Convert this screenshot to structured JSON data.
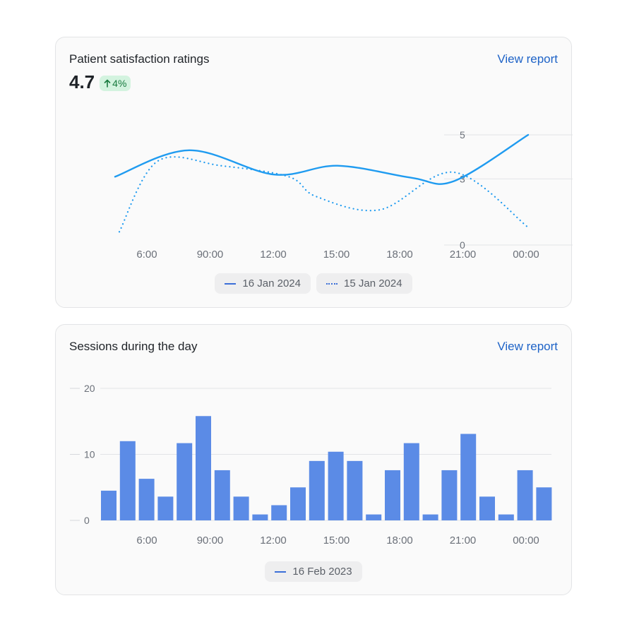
{
  "cards": [
    {
      "title": "Patient satisfaction ratings",
      "link": "View report",
      "kpi": {
        "value": "4.7",
        "change": "4%",
        "direction": "up"
      }
    },
    {
      "title": "Sessions during the day",
      "link": "View report"
    }
  ],
  "chart_data": [
    {
      "type": "line",
      "x_ticks": [
        "6:00",
        "90:00",
        "12:00",
        "15:00",
        "18:00",
        "21:00",
        "00:00"
      ],
      "y_ticks": [
        0,
        3,
        5
      ],
      "ylim": [
        0,
        5
      ],
      "grid": true,
      "legend_position": "bottom",
      "series": [
        {
          "name": "16 Jan 2024",
          "style": "solid",
          "color": "#1f9bf0",
          "x": [
            4.5,
            8,
            12,
            15,
            18.5,
            20.5,
            24
          ],
          "y": [
            3.1,
            4.3,
            3.2,
            3.6,
            3.05,
            2.9,
            5.0
          ]
        },
        {
          "name": "15 Jan 2024",
          "style": "dotted",
          "color": "#1f9bf0",
          "x": [
            4.7,
            6.5,
            9.5,
            12.7,
            14,
            17,
            20.5,
            24
          ],
          "y": [
            0.6,
            3.8,
            3.6,
            3.1,
            2.2,
            1.6,
            3.3,
            0.8
          ]
        }
      ]
    },
    {
      "type": "bar",
      "x_ticks": [
        "6:00",
        "90:00",
        "12:00",
        "15:00",
        "18:00",
        "21:00",
        "00:00"
      ],
      "y_ticks": [
        0,
        10,
        20
      ],
      "ylim": [
        0,
        20
      ],
      "grid": true,
      "legend_position": "bottom",
      "series": [
        {
          "name": "16 Feb 2023",
          "color": "#5b8be6",
          "values": [
            4.5,
            12,
            6.3,
            3.6,
            11.7,
            15.8,
            7.6,
            3.6,
            0.9,
            2.3,
            5,
            9,
            10.4,
            9,
            0.9,
            7.6,
            11.7,
            0.9,
            7.6,
            13.1,
            3.6,
            0.9,
            7.6,
            5
          ]
        }
      ]
    }
  ]
}
